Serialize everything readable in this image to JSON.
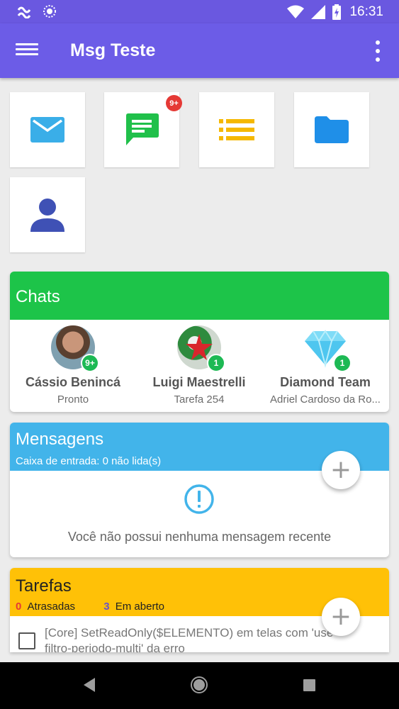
{
  "status_bar": {
    "time": "16:31"
  },
  "app_bar": {
    "title": "Msg Teste"
  },
  "tiles": {
    "messages_badge": "9+"
  },
  "chats": {
    "title": "Chats",
    "items": [
      {
        "name": "Cássio Benincá",
        "subtitle": "Pronto",
        "badge": "9+"
      },
      {
        "name": "Luigi Maestrelli",
        "subtitle": "Tarefa 254",
        "badge": "1"
      },
      {
        "name": "Diamond Team",
        "subtitle": "Adriel Cardoso da Ro...",
        "badge": "1"
      }
    ]
  },
  "mensagens": {
    "title": "Mensagens",
    "subtitle": "Caixa de entrada: 0 não lida(s)",
    "empty_text": "Você não possui nenhuma mensagem recente",
    "add_label": "+"
  },
  "tarefas": {
    "title": "Tarefas",
    "late_count": "0",
    "late_label": "Atrasadas",
    "open_count": "3",
    "open_label": "Em aberto",
    "add_label": "+",
    "items": [
      {
        "text": "[Core] SetReadOnly($ELEMENTO) em telas com 'use-filtro-periodo-multi' da erro"
      }
    ]
  },
  "colors": {
    "app_bar": "#6c5ce7",
    "chats_header": "#1dc449",
    "mensagens_header": "#42b4ea",
    "tarefas_header": "#ffc107",
    "badge": "#e53935"
  }
}
